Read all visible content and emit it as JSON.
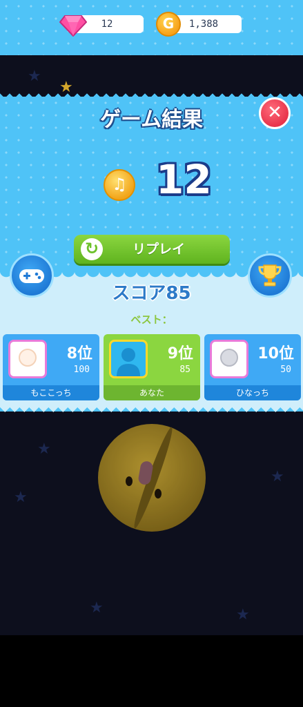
{
  "currency": {
    "gems": "12",
    "coins": "1,388"
  },
  "result": {
    "title": "ゲーム結果",
    "coins_earned": "12",
    "replay_label": "リプレイ",
    "score_text": "スコア85",
    "best_text": "ベスト："
  },
  "ranking": [
    {
      "name": "もここっち",
      "rank": "8位",
      "score": "100",
      "is_me": false
    },
    {
      "name": "あなた",
      "rank": "9位",
      "score": "85",
      "is_me": true
    },
    {
      "name": "ひなっち",
      "rank": "10位",
      "score": "50",
      "is_me": false
    }
  ],
  "icons": {
    "gem": "gem-icon",
    "coin": "coin-icon",
    "close": "close-icon",
    "replay": "replay-icon",
    "gamepad": "gamepad-icon",
    "trophy": "trophy-icon"
  },
  "colors": {
    "panel_blue": "#4fc3f7",
    "replay_green": "#6cc12a",
    "close_red": "#e8344b",
    "score_outline": "#1b3c8a"
  }
}
